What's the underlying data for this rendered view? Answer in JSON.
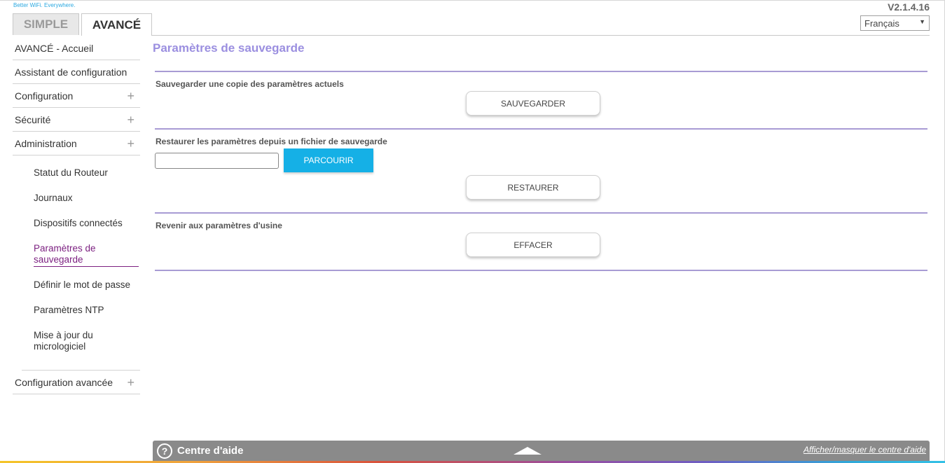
{
  "header": {
    "tagline": "Better WiFi. Everywhere.",
    "version": "V2.1.4.16",
    "tabs": [
      "SIMPLE",
      "AVANCÉ"
    ],
    "language": "Français"
  },
  "sidebar": {
    "top_items": [
      "AVANCÉ - Accueil",
      "Assistant de configuration"
    ],
    "expandable": [
      "Configuration",
      "Sécurité",
      "Administration"
    ],
    "admin_sub_items": [
      "Statut du Routeur",
      "Journaux",
      "Dispositifs connectés",
      "Paramètres de sauvegarde",
      "Définir le mot de passe",
      "Paramètres NTP",
      "Mise à jour du micrologiciel"
    ],
    "active_sub_item": "Paramètres de sauvegarde",
    "advanced_config": "Configuration avancée"
  },
  "main": {
    "title": "Paramètres de sauvegarde",
    "backup": {
      "label": "Sauvegarder une copie des paramètres actuels",
      "button": "SAUVEGARDER"
    },
    "restore": {
      "label": "Restaurer les paramètres depuis un fichier de sauvegarde",
      "file_value": "",
      "browse_button": "PARCOURIR",
      "button": "RESTAURER"
    },
    "factory": {
      "label": "Revenir aux paramètres d'usine",
      "button": "EFFACER"
    }
  },
  "help": {
    "title": "Centre d'aide",
    "toggle_link": "Afficher/masquer le centre d'aide"
  },
  "colors": {
    "accent_purple": "#9b8fe0",
    "active_nav": "#7c2181",
    "browse_blue": "#15b0e6",
    "help_bar": "#8a8a8a"
  }
}
